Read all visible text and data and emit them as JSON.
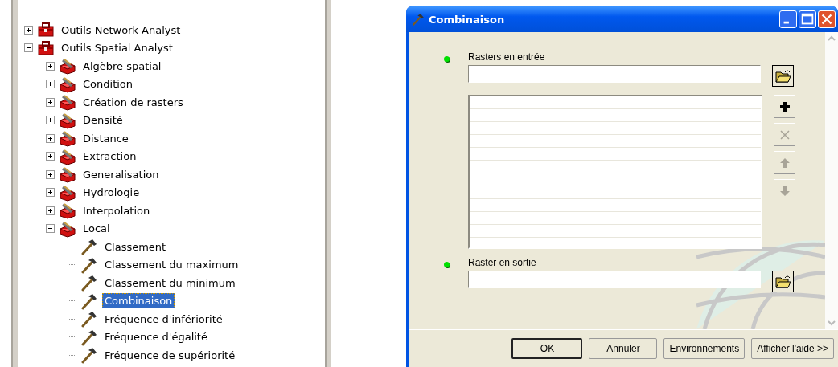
{
  "tree": {
    "items": [
      {
        "label": "Outils Network Analyst",
        "kind": "toolbox",
        "expanded": false,
        "selected": false
      },
      {
        "label": "Outils Spatial Analyst",
        "kind": "toolbox",
        "expanded": true,
        "selected": false,
        "children": [
          {
            "label": "Algèbre spatial",
            "kind": "toolset",
            "expanded": false,
            "selected": false
          },
          {
            "label": "Condition",
            "kind": "toolset",
            "expanded": false,
            "selected": false
          },
          {
            "label": "Création de rasters",
            "kind": "toolset",
            "expanded": false,
            "selected": false
          },
          {
            "label": "Densité",
            "kind": "toolset",
            "expanded": false,
            "selected": false
          },
          {
            "label": "Distance",
            "kind": "toolset",
            "expanded": false,
            "selected": false
          },
          {
            "label": "Extraction",
            "kind": "toolset",
            "expanded": false,
            "selected": false
          },
          {
            "label": "Generalisation",
            "kind": "toolset",
            "expanded": false,
            "selected": false
          },
          {
            "label": "Hydrologie",
            "kind": "toolset",
            "expanded": false,
            "selected": false
          },
          {
            "label": "Interpolation",
            "kind": "toolset",
            "expanded": false,
            "selected": false
          },
          {
            "label": "Local",
            "kind": "toolset",
            "expanded": true,
            "selected": false,
            "children": [
              {
                "label": "Classement",
                "kind": "tool",
                "selected": false
              },
              {
                "label": "Classement du maximum",
                "kind": "tool",
                "selected": false
              },
              {
                "label": "Classement du minimum",
                "kind": "tool",
                "selected": false
              },
              {
                "label": "Combinaison",
                "kind": "tool",
                "selected": true
              },
              {
                "label": "Fréquence d'infériorité",
                "kind": "tool",
                "selected": false
              },
              {
                "label": "Fréquence d'égalité",
                "kind": "tool",
                "selected": false
              },
              {
                "label": "Fréquence de supériorité",
                "kind": "tool",
                "selected": false
              }
            ]
          }
        ]
      }
    ]
  },
  "dialog": {
    "title": "Combinaison",
    "parameters": [
      {
        "label": "Rasters en entrée",
        "required": true,
        "kind": "multi"
      },
      {
        "label": "Raster en sortie",
        "required": true,
        "kind": "single"
      }
    ],
    "list_buttons": [
      {
        "kind": "add",
        "disabled": false
      },
      {
        "kind": "remove",
        "disabled": true
      },
      {
        "kind": "up",
        "disabled": true
      },
      {
        "kind": "down",
        "disabled": true
      }
    ],
    "buttons": [
      {
        "label": "OK",
        "default": true
      },
      {
        "label": "Annuler",
        "default": false
      },
      {
        "label": "Environnements",
        "default": false
      },
      {
        "label": "Afficher l'aide >>",
        "default": false
      }
    ]
  }
}
